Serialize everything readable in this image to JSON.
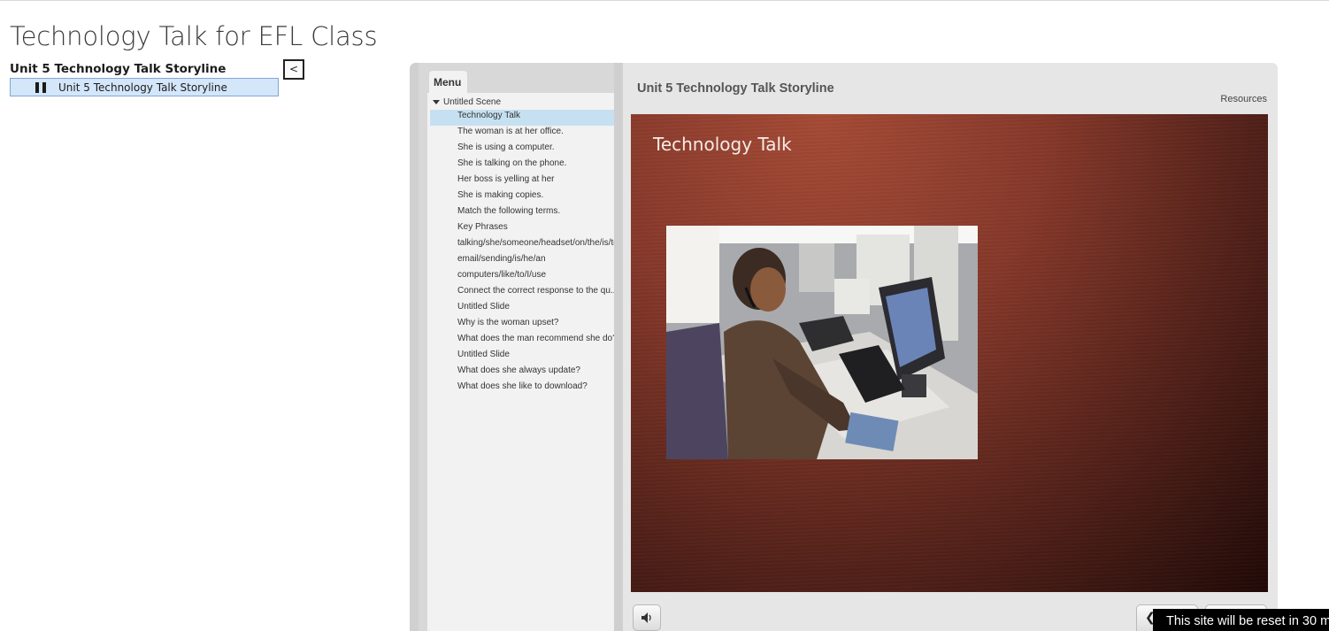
{
  "page": {
    "title": "Technology Talk for EFL Class"
  },
  "course": {
    "heading": "Unit 5 Technology Talk Storyline",
    "collapse_label": "<",
    "tree_item_label": "Unit 5 Technology Talk Storyline"
  },
  "player": {
    "title": "Unit 5 Technology Talk Storyline",
    "resources_label": "Resources",
    "menu_tab": "Menu",
    "scene_label": "Untitled Scene",
    "slides": [
      {
        "label": "Technology Talk",
        "active": true
      },
      {
        "label": "The woman is at her office."
      },
      {
        "label": "She is using a computer."
      },
      {
        "label": "She is talking on the phone."
      },
      {
        "label": "Her boss is yelling at her"
      },
      {
        "label": "She is making copies."
      },
      {
        "label": "Match the following terms."
      },
      {
        "label": "Key Phrases"
      },
      {
        "label": "talking/she/someone/headset/on/the/is/to"
      },
      {
        "label": "email/sending/is/he/an"
      },
      {
        "label": "computers/like/to/I/use"
      },
      {
        "label": "Connect the correct response to the qu..."
      },
      {
        "label": "Untitled Slide"
      },
      {
        "label": "Why is the woman upset?"
      },
      {
        "label": "What does the man recommend she do?"
      },
      {
        "label": "Untitled Slide"
      },
      {
        "label": "What does she always update?"
      },
      {
        "label": "What does she like to download?"
      }
    ],
    "slide_heading": "Technology Talk",
    "controls": {
      "volume_icon": "speaker-icon",
      "prev_icon": "chevron-left-icon"
    }
  },
  "toast": {
    "text": "This site will be reset in 30 m"
  },
  "colors": {
    "active_slide": "#c5e1f1",
    "selected_tree_item": "#d4e6f9",
    "slide_background": "#86382a"
  }
}
